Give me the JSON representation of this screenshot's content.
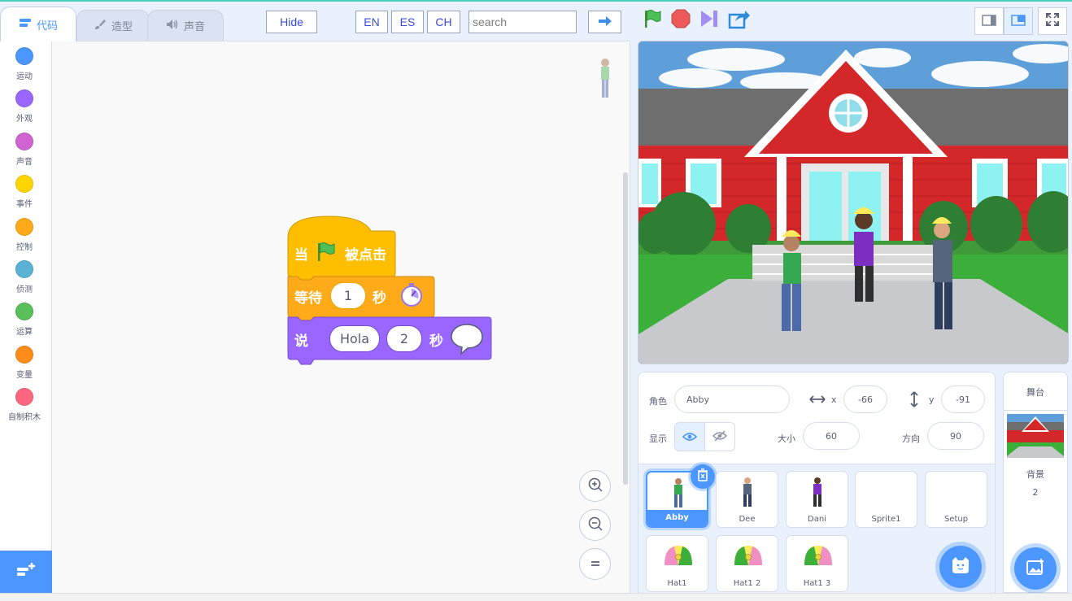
{
  "tabs": [
    {
      "label": "代码",
      "icon": "code-icon"
    },
    {
      "label": "造型",
      "icon": "brush-icon"
    },
    {
      "label": "声音",
      "icon": "speaker-icon"
    }
  ],
  "toolbar": {
    "hide_label": "Hide",
    "lang_en": "EN",
    "lang_es": "ES",
    "lang_ch": "CH",
    "search_placeholder": "search",
    "go_icon": "arrow-right-icon"
  },
  "categories": [
    {
      "label": "运动",
      "color": "#4c97ff"
    },
    {
      "label": "外观",
      "color": "#9966ff"
    },
    {
      "label": "声音",
      "color": "#cf63cf"
    },
    {
      "label": "事件",
      "color": "#ffd500"
    },
    {
      "label": "控制",
      "color": "#ffab19"
    },
    {
      "label": "侦测",
      "color": "#5cb1d6"
    },
    {
      "label": "运算",
      "color": "#59c059"
    },
    {
      "label": "变量",
      "color": "#ff8c1a"
    },
    {
      "label": "自制积木",
      "color": "#ff6680"
    }
  ],
  "script": {
    "hat": {
      "prefix": "当",
      "suffix": "被点击"
    },
    "wait": {
      "label": "等待",
      "value": "1",
      "unit": "秒"
    },
    "say": {
      "label": "说",
      "message": "Hola",
      "seconds": "2",
      "unit": "秒"
    }
  },
  "sprite_info": {
    "sprite_label": "角色",
    "sprite_name": "Abby",
    "x_label": "x",
    "x_value": "-66",
    "y_label": "y",
    "y_value": "-91",
    "show_label": "显示",
    "size_label": "大小",
    "size_value": "60",
    "direction_label": "方向",
    "direction_value": "90"
  },
  "sprites": [
    {
      "name": "Abby",
      "selected": true
    },
    {
      "name": "Dee",
      "selected": false
    },
    {
      "name": "Dani",
      "selected": false
    },
    {
      "name": "Sprite1",
      "selected": false
    },
    {
      "name": "Setup",
      "selected": false
    },
    {
      "name": "Hat1",
      "selected": false
    },
    {
      "name": "Hat1 2",
      "selected": false
    },
    {
      "name": "Hat1 3",
      "selected": false
    }
  ],
  "stage_panel": {
    "title": "舞台",
    "backdrops_label": "背景",
    "backdrops_count": "2"
  },
  "colors": {
    "accent": "#4c97ff",
    "events": "#ffbf00",
    "control": "#ffab19",
    "looks": "#9966ff"
  }
}
